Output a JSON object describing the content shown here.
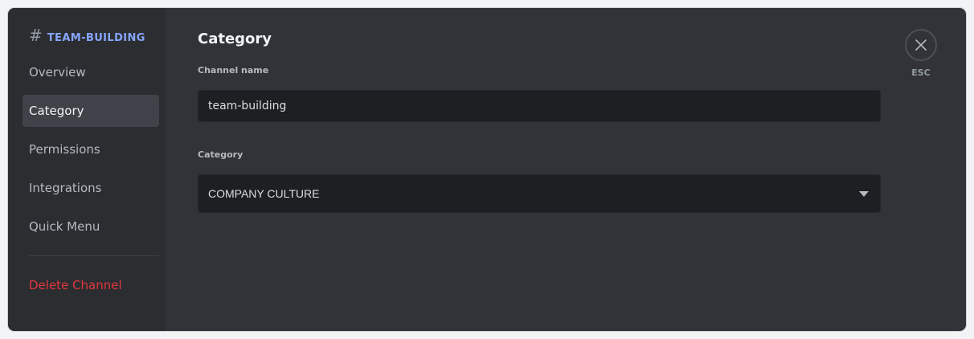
{
  "sidebar": {
    "channel_hash": "#",
    "channel_name": "TEAM-BUILDING",
    "items": [
      {
        "label": "Overview"
      },
      {
        "label": "Category"
      },
      {
        "label": "Permissions"
      },
      {
        "label": "Integrations"
      },
      {
        "label": "Quick Menu"
      }
    ],
    "delete_label": "Delete Channel"
  },
  "main": {
    "title": "Category",
    "channel_name_label": "Channel name",
    "channel_name_value": "team-building",
    "category_label": "Category",
    "category_value": "COMPANY CULTURE"
  },
  "close": {
    "icon": "close-icon",
    "label": "ESC"
  },
  "colors": {
    "accent": "#87a6ff",
    "danger": "#e4363d",
    "background": "#313338",
    "sidebar": "#2b2d31",
    "input": "#1e1f22"
  }
}
